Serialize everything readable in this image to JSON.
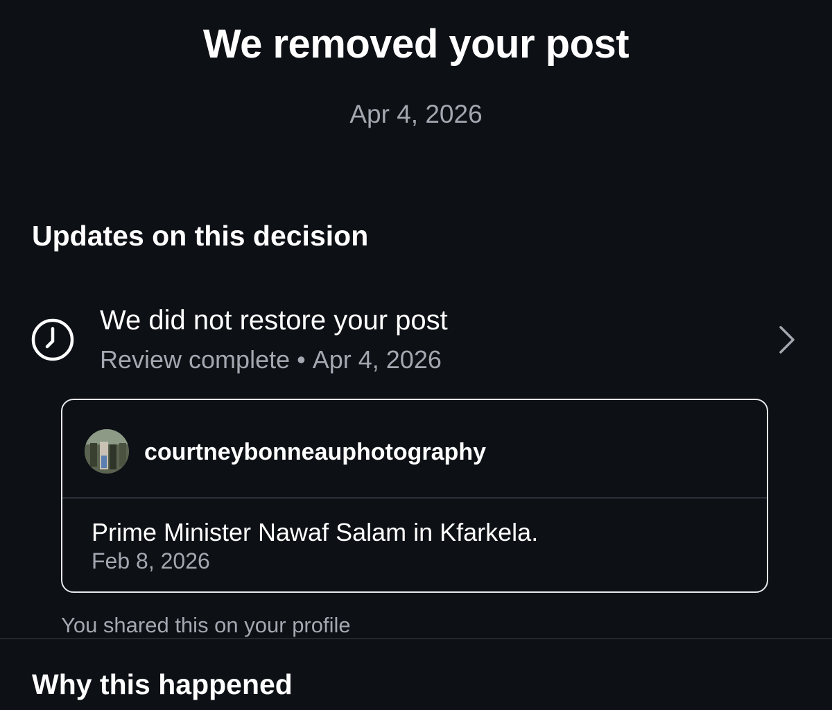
{
  "header": {
    "title": "We removed your post",
    "date": "Apr 4, 2026"
  },
  "updates": {
    "heading": "Updates on this decision",
    "item": {
      "title": "We did not restore your post",
      "status": "Review complete",
      "separator": "•",
      "date": "Apr 4, 2026",
      "icon": "clock-icon",
      "chevron": "chevron-right-icon"
    }
  },
  "post": {
    "username": "courtneybonneauphotography",
    "caption": "Prime Minister Nawaf Salam in Kfarkela.",
    "date": "Feb 8, 2026",
    "shared_note": "You shared this on your profile"
  },
  "why": {
    "heading": "Why this happened"
  },
  "colors": {
    "background": "#0d1015",
    "text_primary": "#ffffff",
    "text_secondary": "#a3a8b0",
    "card_border": "#e8e9eb"
  }
}
